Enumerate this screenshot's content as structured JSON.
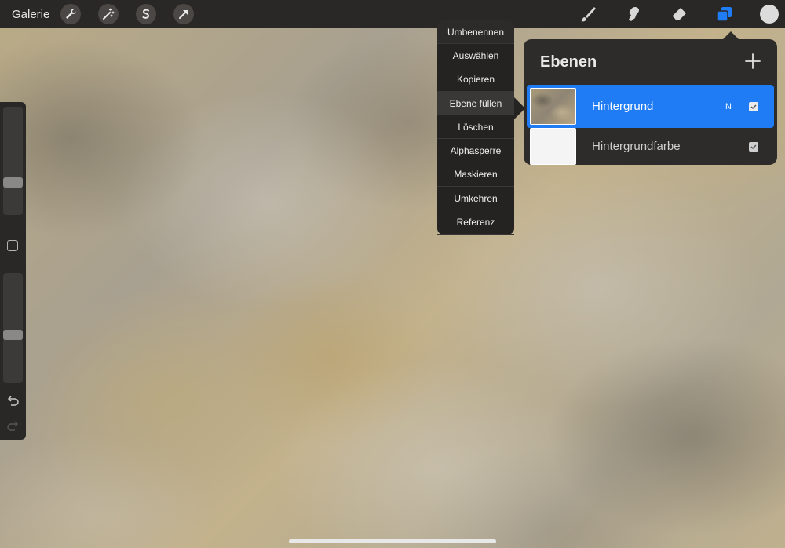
{
  "toolbar": {
    "gallery_label": "Galerie",
    "left_tools": [
      "wrench-icon",
      "magic-wand-icon",
      "selection-icon",
      "transform-arrow-icon"
    ],
    "right_tools": [
      "brush-icon",
      "smudge-icon",
      "eraser-icon",
      "layers-icon"
    ],
    "active_tool": "layers-icon",
    "accent_color": "#1f7cf5"
  },
  "context_menu": {
    "items": [
      "Umbenennen",
      "Auswählen",
      "Kopieren",
      "Ebene füllen",
      "Löschen",
      "Alphasperre",
      "Maskieren",
      "Umkehren",
      "Referenz"
    ],
    "highlighted": "Ebene füllen"
  },
  "layers_panel": {
    "title": "Ebenen",
    "layers": [
      {
        "name": "Hintergrund",
        "blend_mode": "N",
        "visible": true,
        "selected": true
      },
      {
        "name": "Hintergrundfarbe",
        "visible": true,
        "selected": false
      }
    ]
  }
}
